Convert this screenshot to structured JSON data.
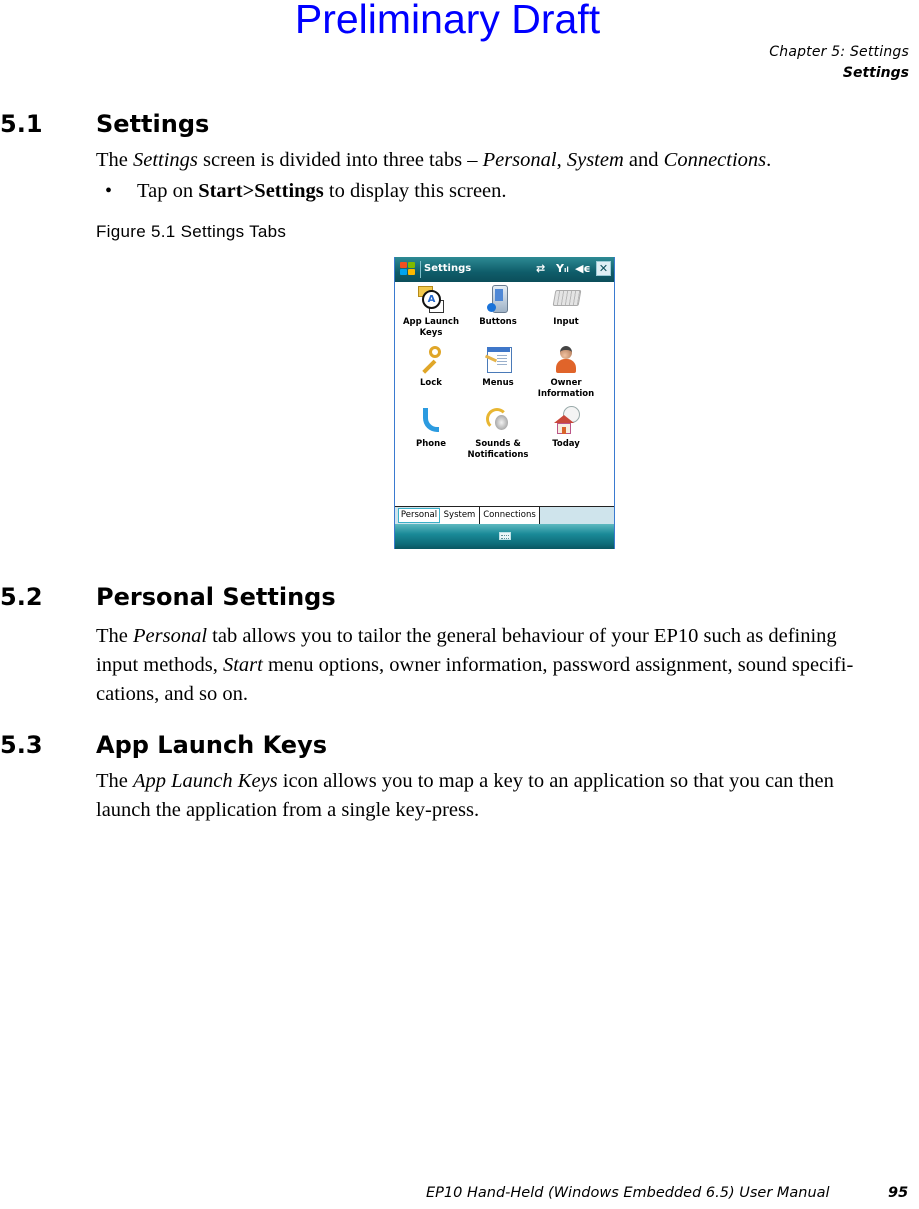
{
  "watermark": "Preliminary Draft",
  "header": {
    "chapter": "Chapter 5: Settings",
    "section": "Settings"
  },
  "sections": [
    {
      "number": "5.1",
      "title": "Settings",
      "intro": {
        "parts": [
          "The ",
          "Settings",
          " screen is divided into three tabs – ",
          "Personal",
          ", ",
          "System",
          " and ",
          "Connections",
          "."
        ]
      },
      "bullet": {
        "marker": "•",
        "parts": [
          "Tap on ",
          "Start>Settings",
          " to display this screen."
        ]
      },
      "figure_caption": "Figure 5.1   Settings Tabs"
    },
    {
      "number": "5.2",
      "title": "Personal Settings",
      "lines": [
        {
          "parts": [
            "The ",
            "Personal",
            " tab allows you to tailor the general behaviour of your EP10 such as defining"
          ]
        },
        {
          "parts": [
            "input methods, ",
            "Start",
            " menu options, owner information, password assignment, sound specifi-"
          ]
        },
        {
          "parts": [
            "cations, and so on."
          ]
        }
      ]
    },
    {
      "number": "5.3",
      "title": "App Launch Keys",
      "lines": [
        {
          "parts": [
            "The ",
            "App Launch Keys",
            " icon allows you to map a key to an application so that you can then"
          ]
        },
        {
          "parts": [
            "launch the application from a single key-press."
          ]
        }
      ]
    }
  ],
  "device": {
    "title": "Settings",
    "status_icons": [
      "connectivity-icon",
      "signal-icon",
      "volume-muted-icon"
    ],
    "close_label": "✕",
    "items": [
      {
        "label_1": "App Launch",
        "label_2": "Keys",
        "icon": "app-launch-keys-icon"
      },
      {
        "label_1": "Buttons",
        "label_2": "",
        "icon": "buttons-icon"
      },
      {
        "label_1": "Input",
        "label_2": "",
        "icon": "input-icon"
      },
      {
        "label_1": "Lock",
        "label_2": "",
        "icon": "lock-icon"
      },
      {
        "label_1": "Menus",
        "label_2": "",
        "icon": "menus-icon"
      },
      {
        "label_1": "Owner",
        "label_2": "Information",
        "icon": "owner-information-icon"
      },
      {
        "label_1": "Phone",
        "label_2": "",
        "icon": "phone-icon"
      },
      {
        "label_1": "Sounds &",
        "label_2": "Notifications",
        "icon": "sounds-notifications-icon"
      },
      {
        "label_1": "Today",
        "label_2": "",
        "icon": "today-icon"
      }
    ],
    "tabs": [
      {
        "label": "Personal",
        "active": true
      },
      {
        "label": "System",
        "active": false
      },
      {
        "label": "Connections",
        "active": false
      }
    ]
  },
  "footer": {
    "title": "EP10 Hand-Held (Windows Embedded 6.5) User Manual",
    "page": "95"
  },
  "colors": {
    "watermark": "#0000ff",
    "titlebar": "#0f5d6a",
    "tabstrip": "#cfe4ec"
  }
}
